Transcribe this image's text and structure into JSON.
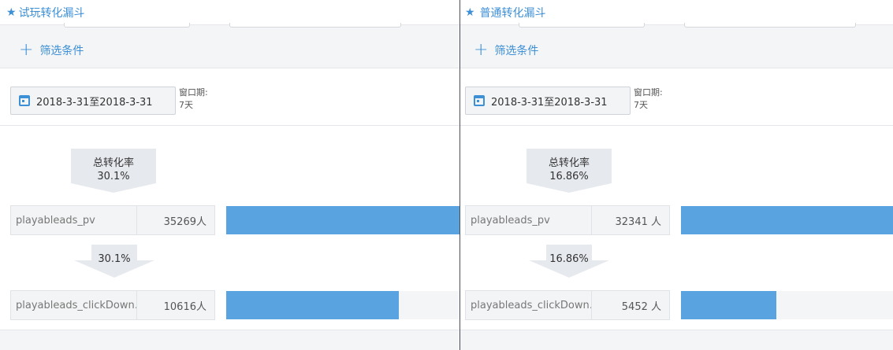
{
  "colors": {
    "accent": "#3d8fd6",
    "bar": "#59a3e0",
    "panel_bg": "#f4f5f7"
  },
  "panels": [
    {
      "title": "试玩转化漏斗",
      "filter_label": "筛选条件",
      "date_range": "2018-3-31至2018-3-31",
      "window_label": "窗口期:",
      "window_value": "7天",
      "total_label": "总转化率",
      "total_rate": "30.1%",
      "step_rate": "30.1%",
      "steps": [
        {
          "name": "playableads_pv",
          "count": "35269人",
          "fraction": 1.0
        },
        {
          "name": "playableads_clickDown…",
          "count": "10616人",
          "fraction": 0.738
        }
      ]
    },
    {
      "title": "普通转化漏斗",
      "filter_label": "筛选条件",
      "date_range": "2018-3-31至2018-3-31",
      "window_label": "窗口期:",
      "window_value": "7天",
      "total_label": "总转化率",
      "total_rate": "16.86%",
      "step_rate": "16.86%",
      "steps": [
        {
          "name": "playableads_pv",
          "count": "32341 人",
          "fraction": 1.0
        },
        {
          "name": "playableads_clickDown…",
          "count": "5452 人",
          "fraction": 0.45
        }
      ]
    }
  ]
}
